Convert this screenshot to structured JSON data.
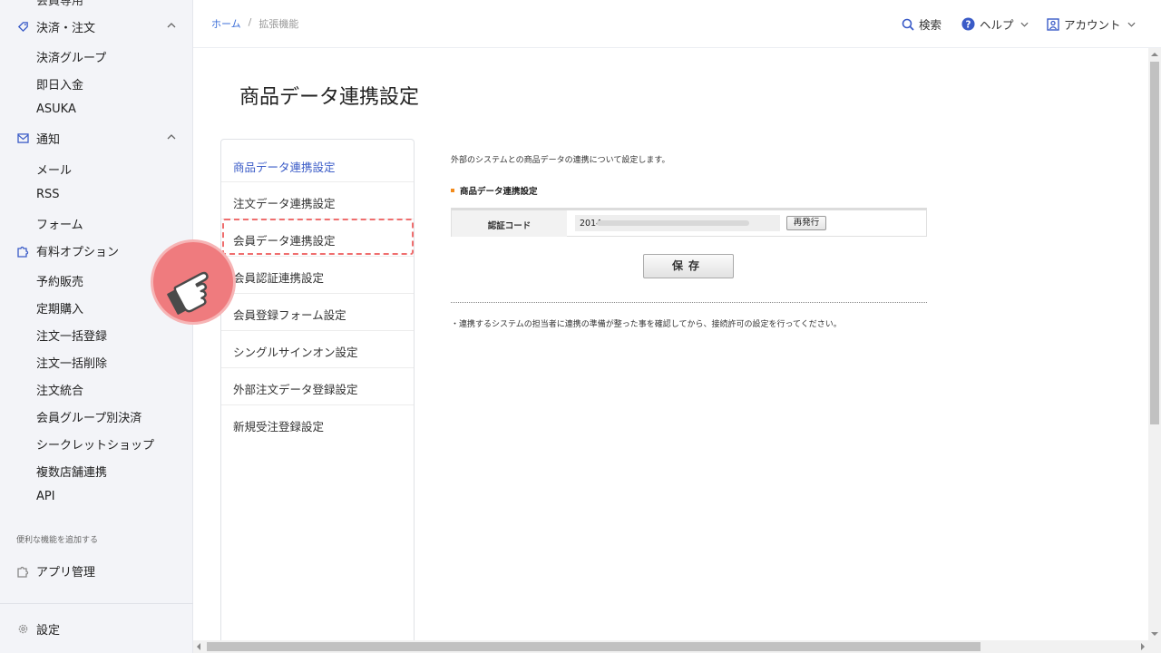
{
  "sidebar": {
    "cut_item": "会員専用",
    "sections": [
      {
        "label": "決済・注文",
        "icon": "tag-icon"
      },
      {
        "label": "通知",
        "icon": "mail-icon"
      },
      {
        "label": "有料オプション",
        "icon": "puzzle-icon"
      }
    ],
    "payment_items": [
      "決済グループ",
      "即日入金",
      "ASUKA"
    ],
    "notify_items": [
      "メール",
      "RSS",
      "フォーム"
    ],
    "option_items": [
      "予約販売",
      "定期購入",
      "注文一括登録",
      "注文一括削除",
      "注文統合",
      "会員グループ別決済",
      "シークレットショップ",
      "複数店舗連携",
      "API"
    ],
    "addon_note": "便利な機能を追加する",
    "app_manage": "アプリ管理",
    "settings": "設定"
  },
  "topbar": {
    "breadcrumb_home": "ホーム",
    "breadcrumb_sep": "/",
    "breadcrumb_current": "拡張機能",
    "search": "検索",
    "help": "ヘルプ",
    "account": "アカウント"
  },
  "page": {
    "title": "商品データ連携設定"
  },
  "menu": {
    "items": [
      "商品データ連携設定",
      "注文データ連携設定",
      "会員データ連携設定",
      "会員認証連携設定",
      "会員登録フォーム設定",
      "シングルサインオン設定",
      "外部注文データ登録設定",
      "新規受注登録設定"
    ],
    "active_index": 0,
    "highlight_index": 2
  },
  "content": {
    "description": "外部のシステムとの商品データの連携について設定します。",
    "section_heading": "商品データ連携設定",
    "auth_label": "認証コード",
    "auth_value_prefix": "2014",
    "reissue_button": "再発行",
    "save_button": "保存",
    "note": "・連携するシステムの担当者に連携の準備が整った事を確認してから、接続許可の設定を行ってください。"
  },
  "colors": {
    "accent": "#3a5bc7",
    "highlight": "#ef6e6e",
    "orange_mark": "#f28b1c"
  }
}
